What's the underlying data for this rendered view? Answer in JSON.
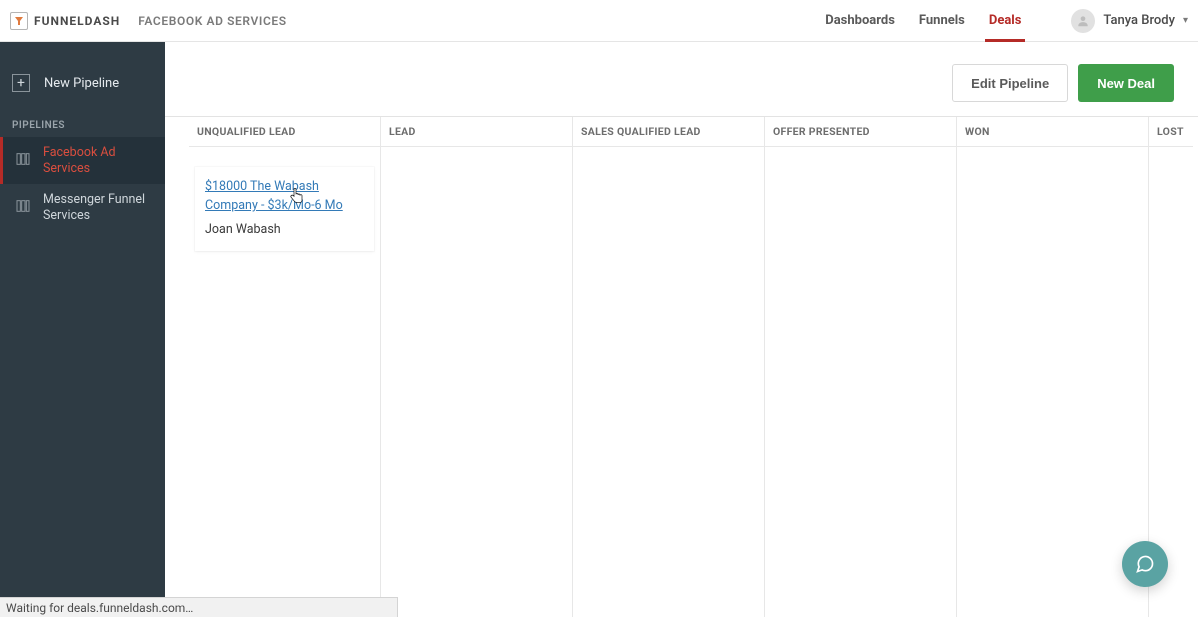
{
  "brand": {
    "name": "FUNNELDASH"
  },
  "breadcrumb": "FACEBOOK AD SERVICES",
  "nav": {
    "items": [
      {
        "label": "Dashboards",
        "active": false
      },
      {
        "label": "Funnels",
        "active": false
      },
      {
        "label": "Deals",
        "active": true
      }
    ],
    "user_name": "Tanya Brody"
  },
  "sidebar": {
    "new_pipeline_label": "New Pipeline",
    "section_label": "PIPELINES",
    "pipelines": [
      {
        "label": "Facebook Ad Services",
        "active": true
      },
      {
        "label": "Messenger Funnel Services",
        "active": false
      }
    ]
  },
  "toolbar": {
    "edit_label": "Edit Pipeline",
    "new_deal_label": "New Deal"
  },
  "board": {
    "columns": [
      {
        "header": "UNQUALIFIED LEAD"
      },
      {
        "header": "LEAD"
      },
      {
        "header": "SALES QUALIFIED LEAD"
      },
      {
        "header": "OFFER PRESENTED"
      },
      {
        "header": "WON"
      },
      {
        "header": "LOST"
      }
    ],
    "cards": [
      {
        "column": 0,
        "title": "$18000 The Wabash Company - $3k/Mo-6 Mo",
        "contact": "Joan Wabash"
      }
    ]
  },
  "status_text": "Waiting for deals.funneldash.com…"
}
